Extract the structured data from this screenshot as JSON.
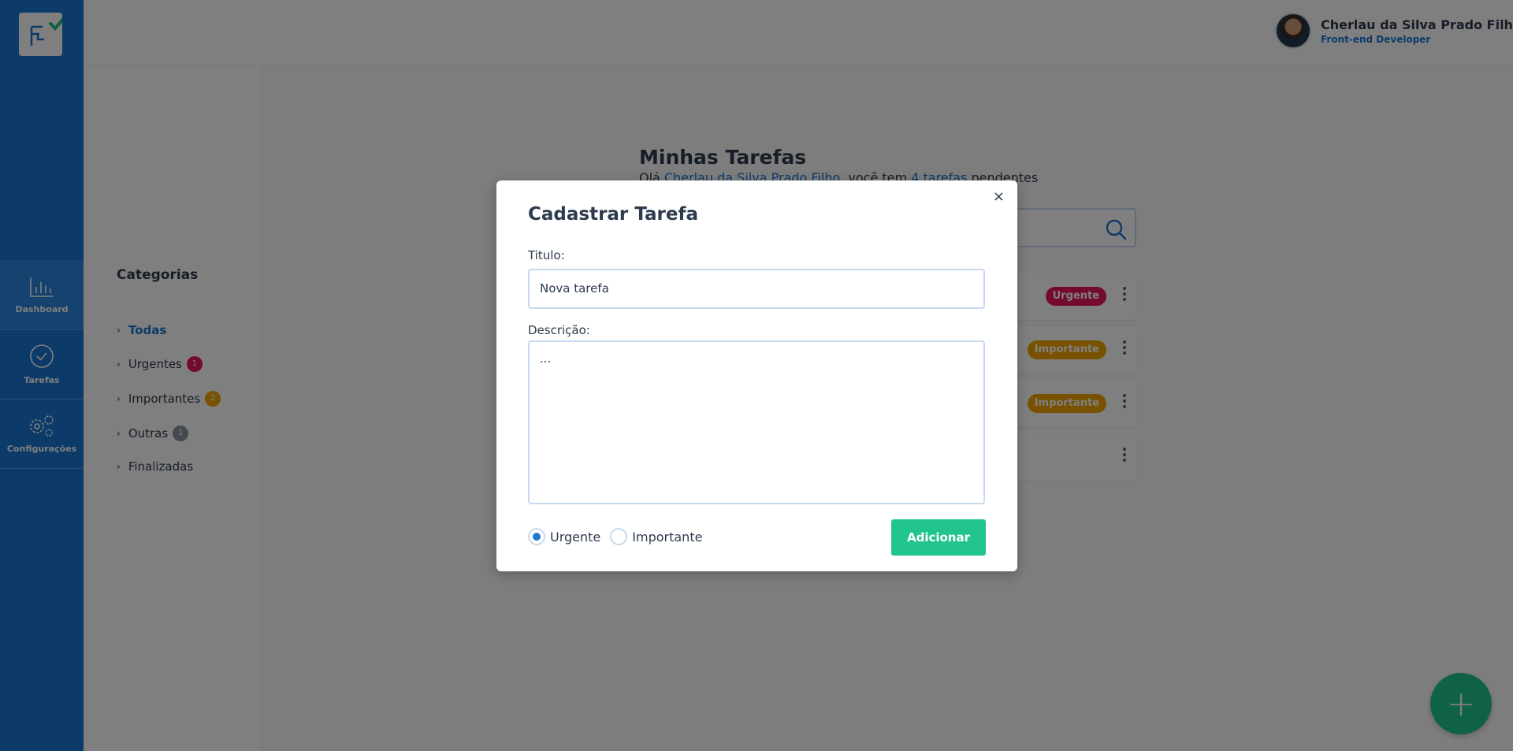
{
  "sidebar": {
    "items": [
      {
        "label": "Dashboard",
        "icon": "chart-bar-icon"
      },
      {
        "label": "Tarefas",
        "icon": "check-circle-icon"
      },
      {
        "label": "Configurações",
        "icon": "gears-icon"
      }
    ]
  },
  "header": {
    "user_name": "Cherlau da Silva Prado Filho",
    "user_role": "Front-end Developer"
  },
  "categories": {
    "title": "Categorias",
    "items": [
      {
        "label": "Todas",
        "badge": null
      },
      {
        "label": "Urgentes",
        "badge": "1"
      },
      {
        "label": "Importantes",
        "badge": "2"
      },
      {
        "label": "Outras",
        "badge": "1"
      },
      {
        "label": "Finalizadas",
        "badge": null
      }
    ]
  },
  "main": {
    "title": "Minhas Tarefas",
    "subtitle_prefix": "Olá ",
    "subtitle_name": "Cherlau da Silva Prado Filho",
    "subtitle_middle": ", você tem ",
    "subtitle_count": "4 tarefas",
    "subtitle_suffix": " pendentes",
    "tasks": [
      {
        "tag": "Urgente"
      },
      {
        "tag": "Importante"
      },
      {
        "tag": "Importante"
      },
      {
        "tag": ""
      }
    ]
  },
  "modal": {
    "title": "Cadastrar Tarefa",
    "close_label": "×",
    "title_label": "Titulo:",
    "title_value": "Nova tarefa",
    "description_label": "Descrição:",
    "description_value": "...",
    "radio_options": [
      "Urgente",
      "Importante"
    ],
    "selected_option": "Urgente",
    "submit_label": "Adicionar"
  },
  "fab_label": "+",
  "colors": {
    "primary": "#1976d2",
    "success": "#21c58b",
    "urgent": "#e8175d",
    "important": "#f0a500",
    "other": "#8a94a3"
  }
}
